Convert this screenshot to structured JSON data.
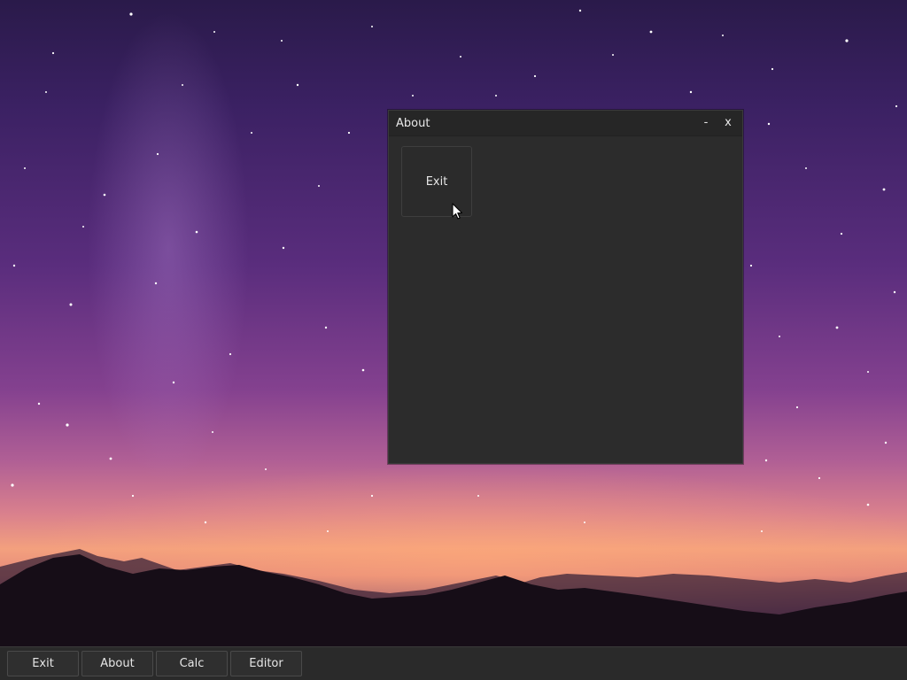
{
  "window": {
    "title": "About",
    "minimize_label": "-",
    "close_label": "x",
    "content_button_label": "Exit"
  },
  "taskbar": {
    "items": [
      {
        "label": "Exit"
      },
      {
        "label": "About"
      },
      {
        "label": "Calc"
      },
      {
        "label": "Editor"
      }
    ]
  },
  "icons": {
    "cursor": "arrow-cursor-icon"
  },
  "colors": {
    "window_bg": "#2c2c2c",
    "titlebar_bg": "#262626",
    "taskbar_bg": "#2a2a2a",
    "text": "#e8e8e8"
  }
}
